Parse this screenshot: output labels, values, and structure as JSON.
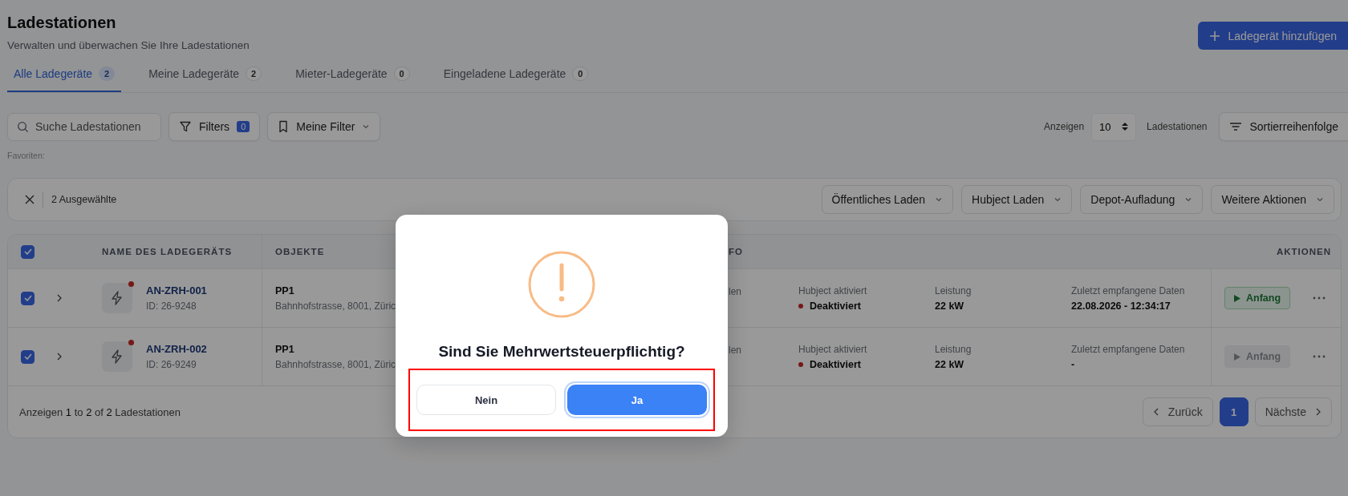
{
  "page": {
    "title": "Ladestationen",
    "subtitle": "Verwalten und überwachen Sie Ihre Ladestationen",
    "add_button": "Ladegerät hinzufügen"
  },
  "tabs": [
    {
      "label": "Alle Ladegeräte",
      "count": "2",
      "selected": true
    },
    {
      "label": "Meine Ladegeräte",
      "count": "2",
      "selected": false
    },
    {
      "label": "Mieter-Ladegeräte",
      "count": "0",
      "selected": false
    },
    {
      "label": "Eingeladene Ladegeräte",
      "count": "0",
      "selected": false
    }
  ],
  "toolbar": {
    "search_placeholder": "Suche Ladestationen",
    "filters_label": "Filters",
    "filters_count": "0",
    "my_filters": "Meine Filter",
    "show_label": "Anzeigen",
    "page_size": "10",
    "unit_label": "Ladestationen",
    "sort_button": "Sortierreihenfolge",
    "favorites_label": "Favoriten:"
  },
  "selection_bar": {
    "text": "2 Ausgewählte",
    "actions": [
      "Öffentliches Laden",
      "Hubject Laden",
      "Depot-Aufladung",
      "Weitere Aktionen"
    ]
  },
  "table": {
    "select_all_checked": true,
    "columns": [
      "NAME DES LADEGERÄTS",
      "OBJEKTE",
      "FO",
      "AKTIONEN"
    ],
    "rows": [
      {
        "checked": true,
        "name": "AN-ZRH-001",
        "id": "ID: 26-9248",
        "object": "PP1",
        "address": "Bahnhofstrasse, 8001, Züric",
        "column_4": "len",
        "hubject_label": "Hubject aktiviert",
        "hubject_value": "Deaktiviert",
        "power_label": "Leistung",
        "power_value": "22 kW",
        "data_label": "Zuletzt empfangene Daten",
        "data_value": "22.08.2026 - 12:34:17",
        "action": "Anfang",
        "action_disabled": false
      },
      {
        "checked": true,
        "name": "AN-ZRH-002",
        "id": "ID: 26-9249",
        "object": "PP1",
        "address": "Bahnhofstrasse, 8001, Züric",
        "column_4": "len",
        "hubject_label": "Hubject aktiviert",
        "hubject_value": "Deaktiviert",
        "power_label": "Leistung",
        "power_value": "22 kW",
        "data_label": "Zuletzt empfangene Daten",
        "data_value": "-",
        "action": "Anfang",
        "action_disabled": true
      }
    ],
    "footer": "Anzeigen **1** to **2** of **2** Ladestationen",
    "pagination": {
      "prev": "Zurück",
      "pages": [
        {
          "label": "1",
          "selected": true
        }
      ],
      "next": "Nächste"
    }
  },
  "dialog": {
    "title": "Sind Sie Mehrwertsteuerpflichtig?",
    "buttons": [
      {
        "label": "Nein",
        "kind": "secondary"
      },
      {
        "label": "Ja",
        "kind": "primary"
      }
    ],
    "highlighted": true
  }
}
